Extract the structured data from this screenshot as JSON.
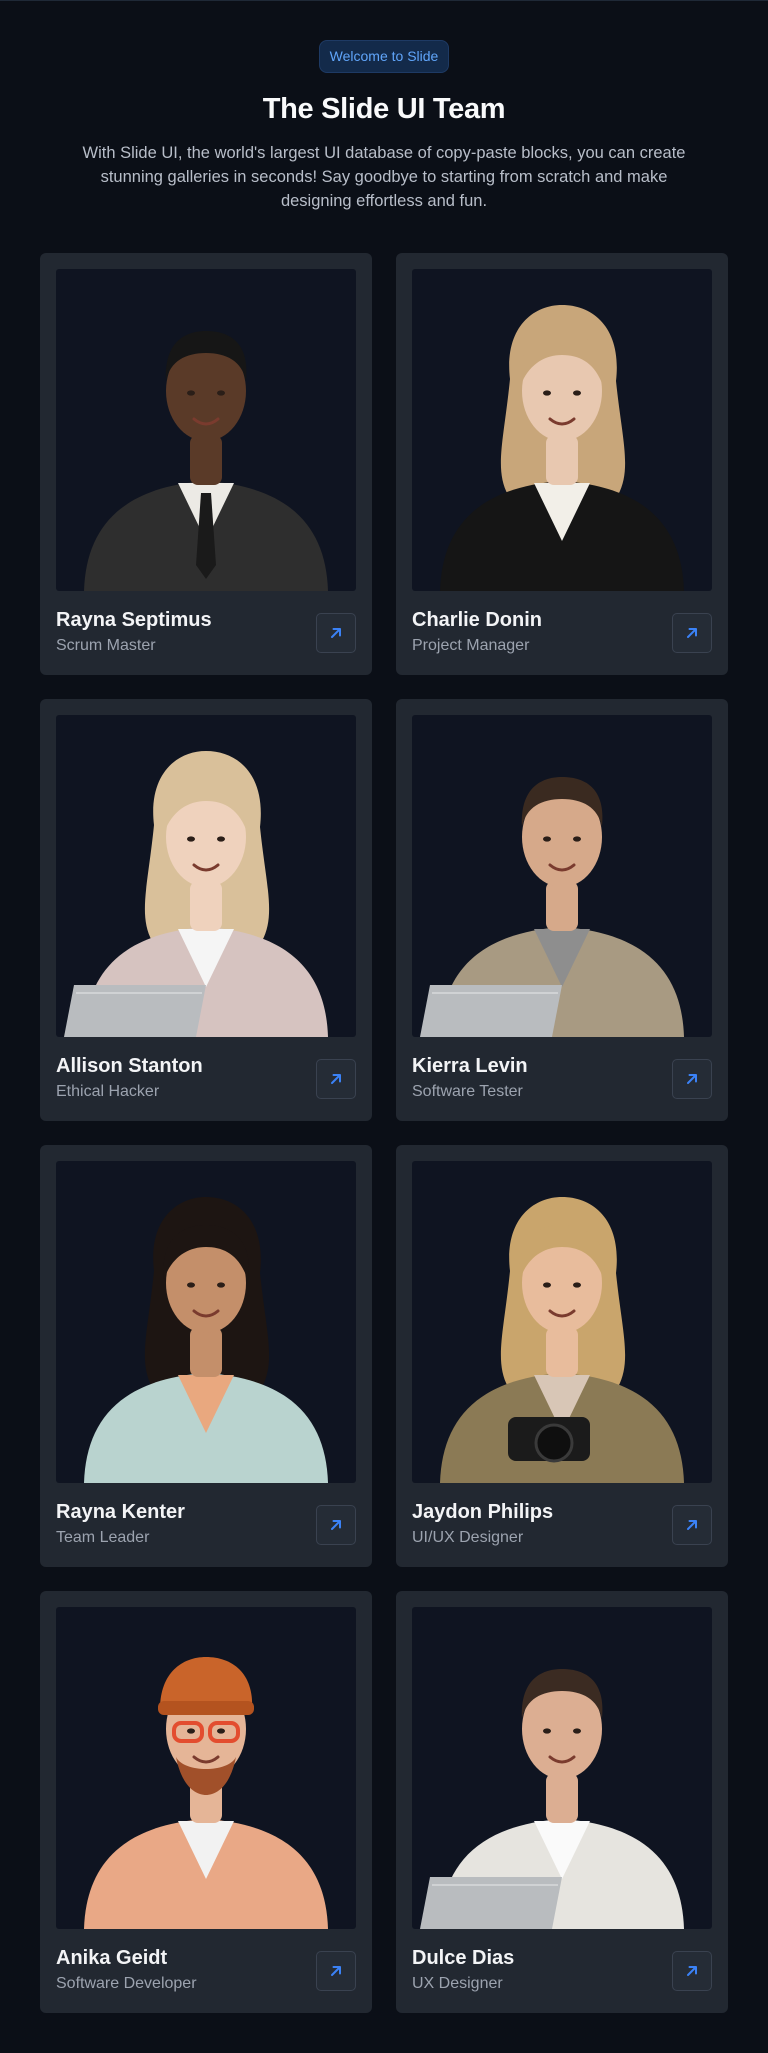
{
  "header": {
    "badge": "Welcome to Slide",
    "title": "The Slide UI Team",
    "subtitle": "With Slide UI, the world's largest UI database of copy-paste blocks, you can create stunning galleries in seconds! Say goodbye to starting from scratch and make designing effortless and fun."
  },
  "team": [
    {
      "name": "Rayna Septimus",
      "role": "Scrum Master",
      "skin": "#5a3a28",
      "hair": "#161616",
      "outfit": "#2e2e2e",
      "shirt": "#eceae5",
      "accent": "#1a1a1a",
      "hairStyle": "short"
    },
    {
      "name": "Charlie Donin",
      "role": "Project Manager",
      "skin": "#e8c8b0",
      "hair": "#c8a67a",
      "outfit": "#151515",
      "shirt": "#f2efe8",
      "accent": "#151515",
      "hairStyle": "long"
    },
    {
      "name": "Allison Stanton",
      "role": "Ethical Hacker",
      "skin": "#efd2bd",
      "hair": "#d9c09a",
      "outfit": "#d6c3c0",
      "shirt": "#f5f5f5",
      "accent": "#a9abae",
      "hairStyle": "long",
      "laptop": true
    },
    {
      "name": "Kierra Levin",
      "role": "Software Tester",
      "skin": "#d6a98a",
      "hair": "#3a2a20",
      "outfit": "#a89a82",
      "shirt": "#8e8e8e",
      "accent": "#bdbdbd",
      "hairStyle": "short",
      "laptop": true
    },
    {
      "name": "Rayna Kenter",
      "role": "Team Leader",
      "skin": "#c48f6a",
      "hair": "#1d1512",
      "outfit": "#b9d3cf",
      "shirt": "#e9a87f",
      "accent": "#b9d3cf",
      "hairStyle": "long"
    },
    {
      "name": "Jaydon Philips",
      "role": "UI/UX Designer",
      "skin": "#e8bc9c",
      "hair": "#c9a56c",
      "outfit": "#8b7a55",
      "shirt": "#d8c6b6",
      "accent": "#1a1a1a",
      "hairStyle": "long",
      "camera": true
    },
    {
      "name": "Anika Geidt",
      "role": "Software Developer",
      "skin": "#e5b597",
      "hair": "#c9642a",
      "outfit": "#e9a886",
      "shirt": "#f2f2f2",
      "accent": "#e34d2f",
      "hairStyle": "beanie"
    },
    {
      "name": "Dulce Dias",
      "role": "UX Designer",
      "skin": "#dcae92",
      "hair": "#3b2b22",
      "outfit": "#e6e4df",
      "shirt": "#fafafa",
      "accent": "#c4c6c8",
      "hairStyle": "short",
      "laptop": true
    }
  ]
}
